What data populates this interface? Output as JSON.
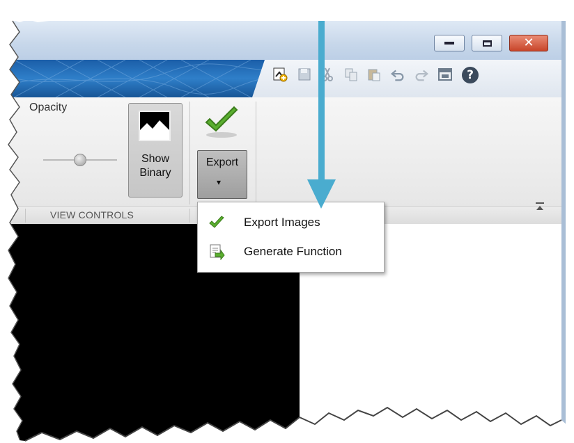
{
  "window": {
    "controls": [
      "minimize",
      "maximize",
      "close"
    ],
    "close_glyph": "✕"
  },
  "toolstrip": {
    "icons": [
      "new-document-icon",
      "save-icon",
      "cut-icon",
      "copy-icon",
      "paste-icon",
      "undo-icon",
      "redo-icon",
      "layout-icon",
      "help-icon"
    ],
    "help_glyph": "?"
  },
  "ribbon": {
    "opacity_label": "Opacity",
    "show_binary": {
      "line1": "Show",
      "line2": "Binary"
    },
    "export": {
      "label": "Export",
      "caret": "▾",
      "icon": "green-check-icon"
    },
    "section_title": "VIEW CONTROLS"
  },
  "export_menu": {
    "items": [
      {
        "label": "Export Images",
        "icon": "green-check-icon"
      },
      {
        "label": "Generate Function",
        "icon": "generate-function-icon"
      }
    ]
  },
  "colors": {
    "accent_blue": "#2f7fc9",
    "arrow": "#4aaccf",
    "check_green": "#5aae2f",
    "close_red": "#c8452a"
  }
}
